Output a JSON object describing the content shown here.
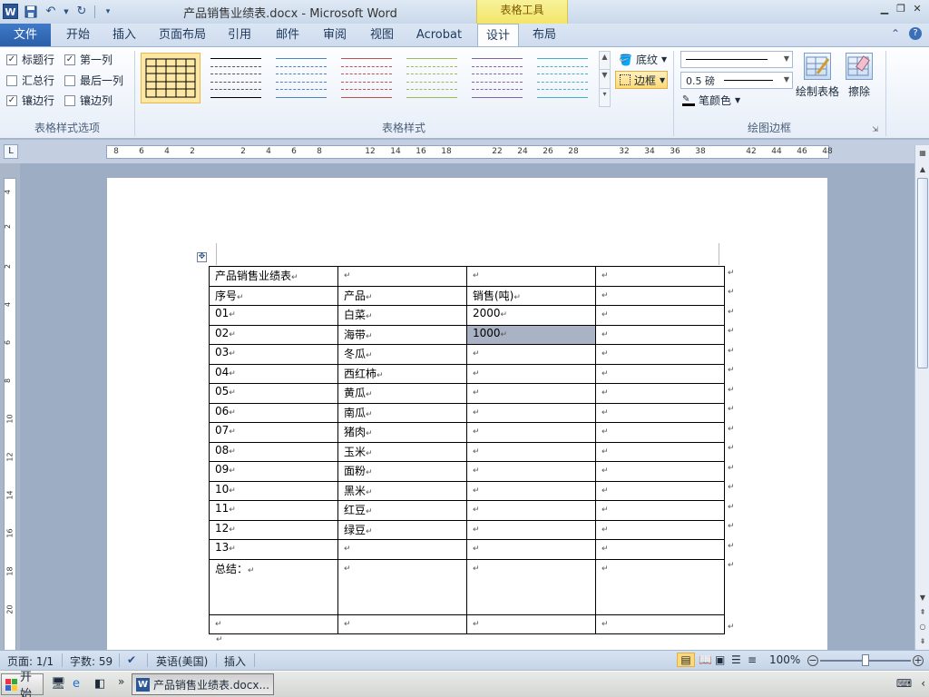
{
  "window": {
    "title": "产品销售业绩表.docx - Microsoft Word",
    "context_tab": "表格工具",
    "app_icon": "W"
  },
  "tabs": {
    "file": "文件",
    "items": [
      "开始",
      "插入",
      "页面布局",
      "引用",
      "邮件",
      "审阅",
      "视图",
      "Acrobat",
      "设计",
      "布局"
    ],
    "active": "设计"
  },
  "ribbon": {
    "options": {
      "group_label": "表格样式选项",
      "header_row": "标题行",
      "first_column": "第一列",
      "total_row": "汇总行",
      "last_column": "最后一列",
      "banded_rows": "镶边行",
      "banded_columns": "镶边列"
    },
    "styles": {
      "group_label": "表格样式",
      "shading": "底纹",
      "borders": "边框"
    },
    "draw": {
      "group_label": "绘图边框",
      "pen_weight": "0.5 磅",
      "pen_color": "笔颜色",
      "draw_table": "绘制表格",
      "eraser": "擦除"
    }
  },
  "ruler": {
    "h_ticks": [
      "8",
      "6",
      "4",
      "2",
      "2",
      "4",
      "6",
      "8",
      "12",
      "14",
      "16",
      "18",
      "22",
      "24",
      "26",
      "28",
      "32",
      "34",
      "36",
      "38",
      "42",
      "44",
      "46",
      "48"
    ],
    "v_ticks": [
      "4",
      "2",
      "2",
      "4",
      "6",
      "8",
      "10",
      "12",
      "14",
      "16",
      "18",
      "20"
    ]
  },
  "table": {
    "title": "产品销售业绩表",
    "header": [
      "序号",
      "产品",
      "销售(吨)"
    ],
    "rows": [
      [
        "01",
        "白菜",
        "2000"
      ],
      [
        "02",
        "海带",
        "1000"
      ],
      [
        "03",
        "冬瓜",
        ""
      ],
      [
        "04",
        "西红柿",
        ""
      ],
      [
        "05",
        "黄瓜",
        ""
      ],
      [
        "06",
        "南瓜",
        ""
      ],
      [
        "07",
        "猪肉",
        ""
      ],
      [
        "08",
        "玉米",
        ""
      ],
      [
        "09",
        "面粉",
        ""
      ],
      [
        "10",
        "黑米",
        ""
      ],
      [
        "11",
        "红豆",
        ""
      ],
      [
        "12",
        "绿豆",
        ""
      ],
      [
        "13",
        "",
        ""
      ]
    ],
    "summary_label": "总结：",
    "cell_mark": "↵"
  },
  "status": {
    "page": "页面: 1/1",
    "words": "字数: 59",
    "language": "英语(美国)",
    "mode": "插入",
    "zoom": "100%"
  },
  "taskbar": {
    "start": "开始",
    "task": "产品销售业绩表.docx..."
  }
}
